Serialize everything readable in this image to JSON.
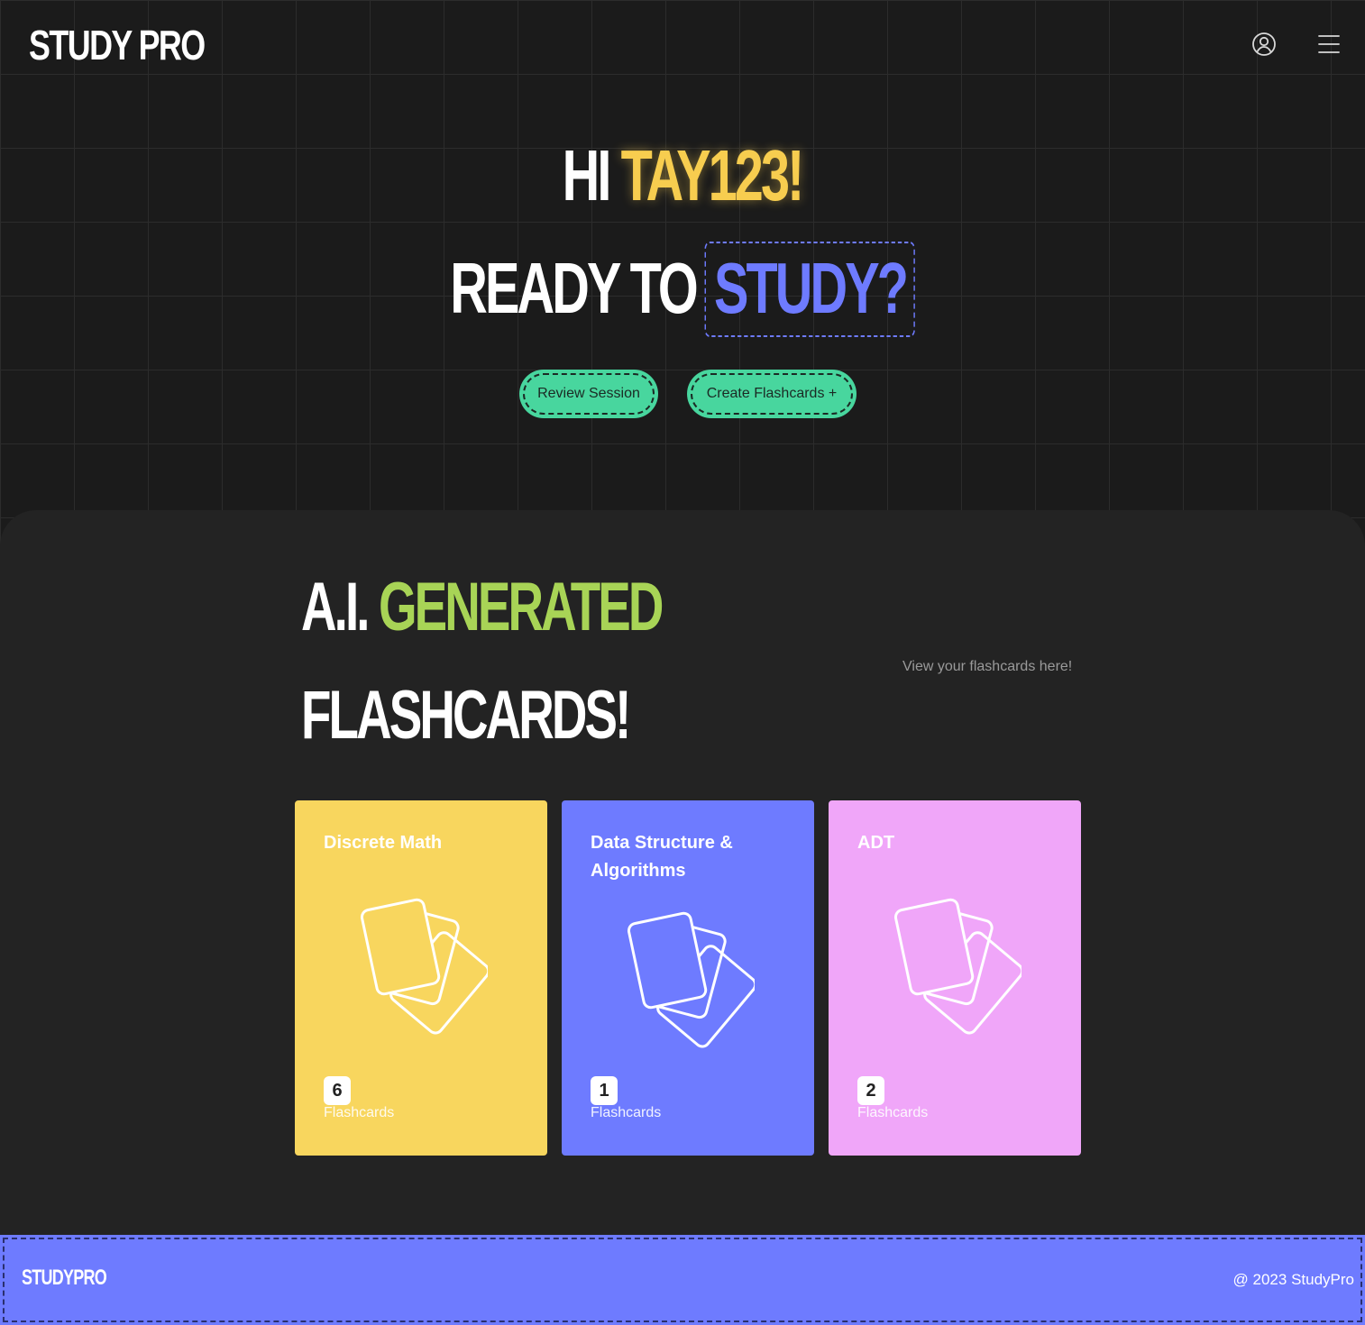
{
  "header": {
    "brand": "STUDY PRO",
    "icons": [
      "user-circle-icon",
      "hamburger-menu-icon"
    ]
  },
  "hero": {
    "greeting_prefix": "HI",
    "username": "TAY123!",
    "ready_prefix": "READY TO",
    "ready_highlight": "STUDY?",
    "review_button": "Review Session",
    "create_button": "Create Flashcards +"
  },
  "section": {
    "title_prefix": "A.I.",
    "title_highlight": "GENERATED",
    "title_line2": "FLASHCARDS!",
    "subtitle": "View your flashcards here!"
  },
  "decks": [
    {
      "title": "Discrete Math",
      "count": "6",
      "label": "Flashcards",
      "color": "#f8d65e"
    },
    {
      "title": "Data Structure & Algorithms",
      "count": "1",
      "label": "Flashcards",
      "color": "#6e7bff"
    },
    {
      "title": "ADT",
      "count": "2",
      "label": "Flashcards",
      "color": "#f0a6f9"
    }
  ],
  "footer": {
    "brand": "STUDYPRO",
    "copyright": "@ 2023 StudyPro"
  },
  "colors": {
    "accent_yellow": "#f7cd4f",
    "accent_blue": "#6e7bff",
    "accent_green": "#a8d456",
    "button_green": "#48d69e",
    "background": "#1b1b1b"
  }
}
